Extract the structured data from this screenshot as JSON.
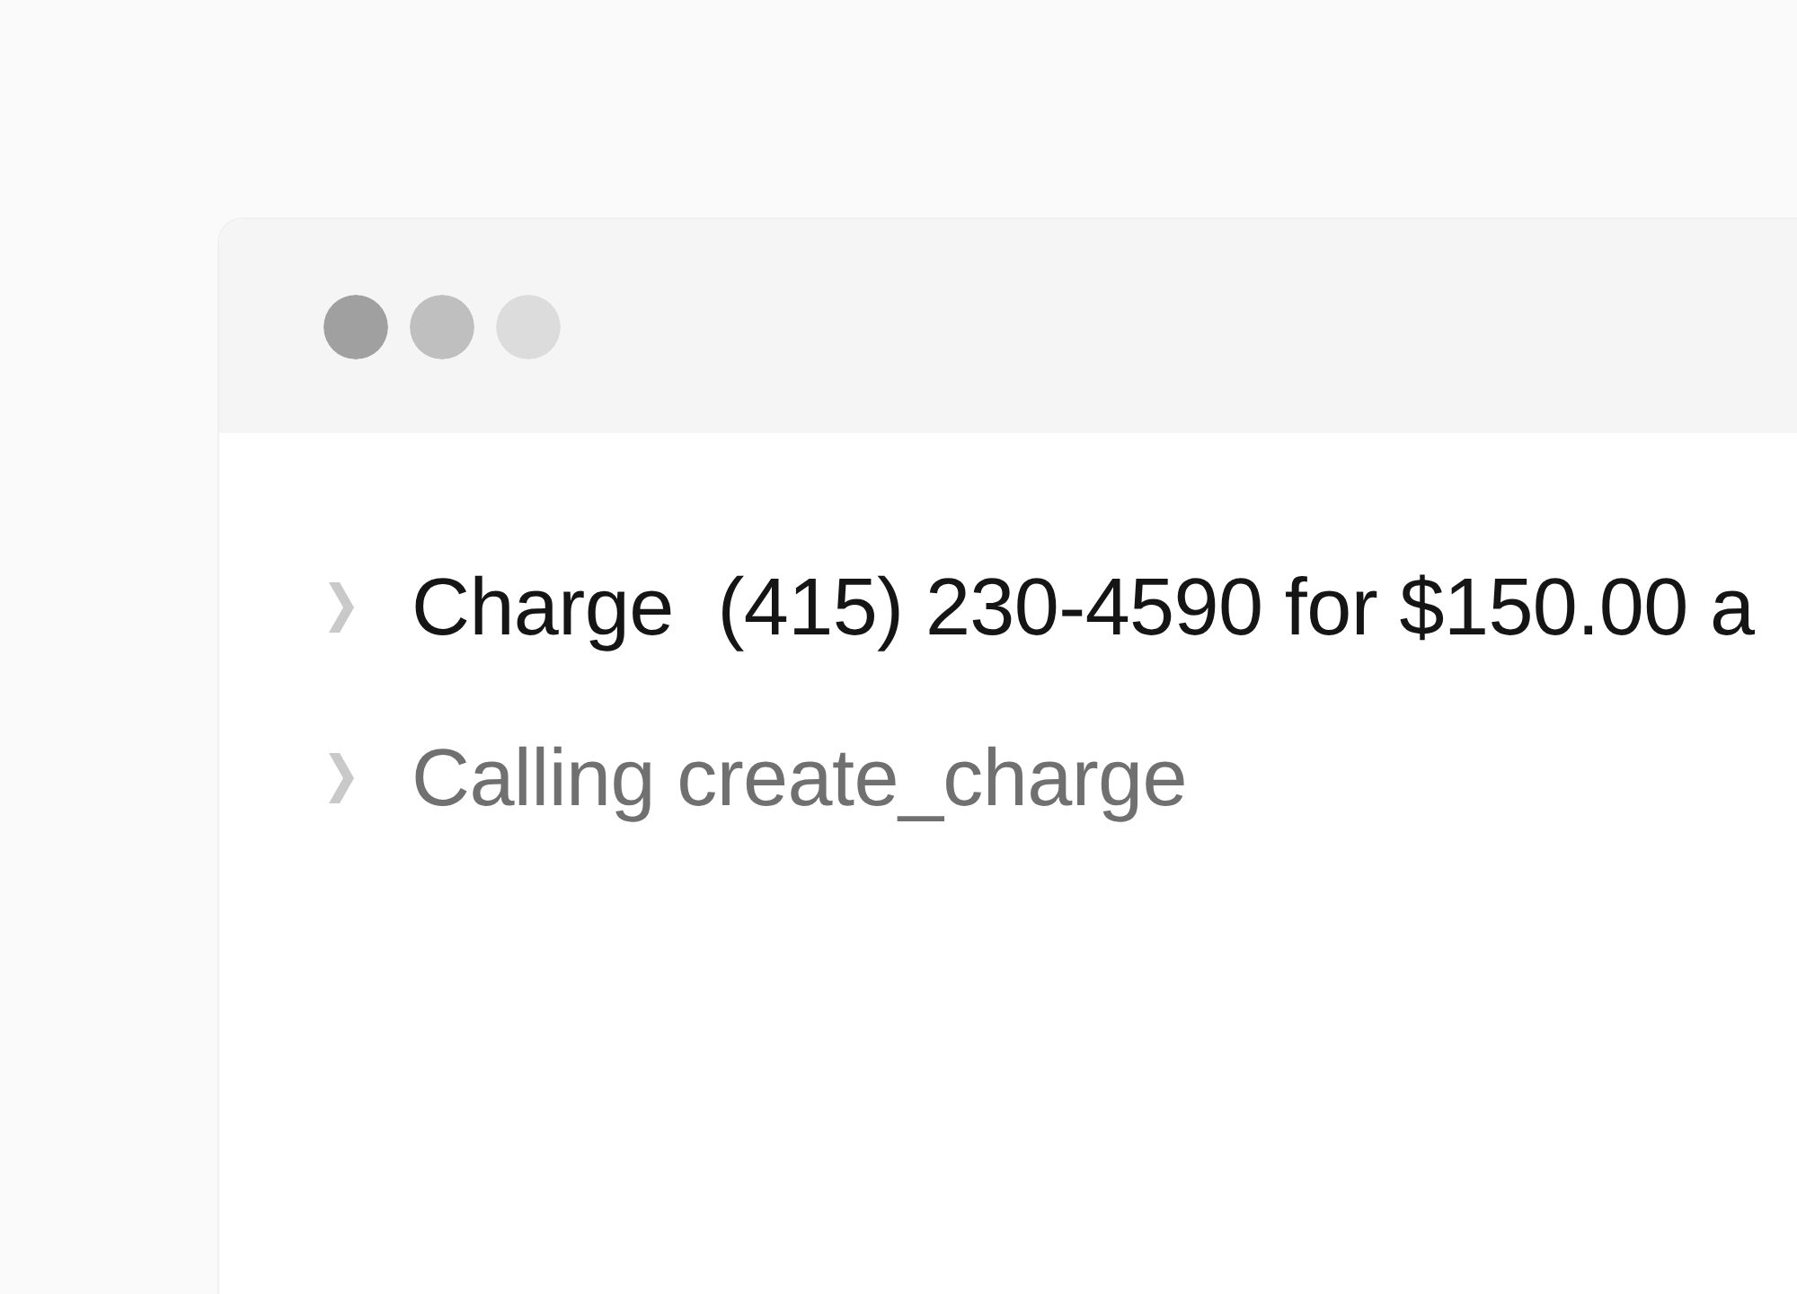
{
  "window": {
    "title_bar": {
      "dots": [
        {
          "color": "#a0a0a0"
        },
        {
          "color": "#bfbfbf"
        },
        {
          "color": "#dcdcdc"
        }
      ]
    }
  },
  "messages": [
    {
      "kind": "user_message",
      "expanded": false,
      "text": "Charge  (415) 230-4590 for $150.00 a"
    },
    {
      "kind": "tool_call",
      "expanded": false,
      "text": "Calling create_charge"
    }
  ]
}
